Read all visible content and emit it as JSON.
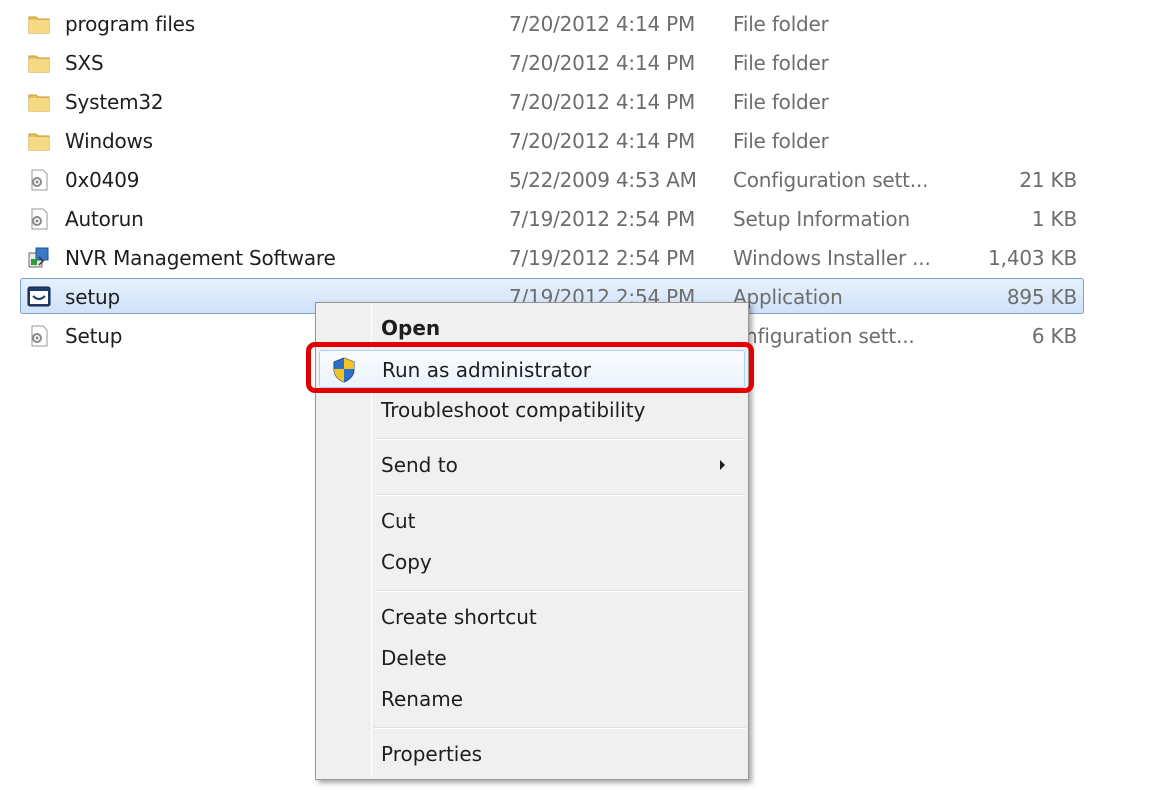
{
  "files": [
    {
      "name": "program files",
      "date": "7/20/2012 4:14 PM",
      "type": "File folder",
      "size": "",
      "icon": "folder-icon"
    },
    {
      "name": "SXS",
      "date": "7/20/2012 4:14 PM",
      "type": "File folder",
      "size": "",
      "icon": "folder-icon"
    },
    {
      "name": "System32",
      "date": "7/20/2012 4:14 PM",
      "type": "File folder",
      "size": "",
      "icon": "folder-icon"
    },
    {
      "name": "Windows",
      "date": "7/20/2012 4:14 PM",
      "type": "File folder",
      "size": "",
      "icon": "folder-icon"
    },
    {
      "name": "0x0409",
      "date": "5/22/2009 4:53 AM",
      "type": "Configuration sett...",
      "size": "21 KB",
      "icon": "config-file-icon"
    },
    {
      "name": "Autorun",
      "date": "7/19/2012 2:54 PM",
      "type": "Setup Information",
      "size": "1 KB",
      "icon": "config-file-icon"
    },
    {
      "name": "NVR Management Software",
      "date": "7/19/2012 2:54 PM",
      "type": "Windows Installer ...",
      "size": "1,403 KB",
      "icon": "installer-icon"
    },
    {
      "name": "setup",
      "date": "7/19/2012 2:54 PM",
      "type": "Application",
      "size": "895 KB",
      "icon": "application-icon",
      "selected": true
    },
    {
      "name": "Setup",
      "date": "",
      "type": "onfiguration sett...",
      "size": "6 KB",
      "icon": "config-file-icon"
    }
  ],
  "context_menu": {
    "open": "Open",
    "run_as_admin": "Run as administrator",
    "troubleshoot": "Troubleshoot compatibility",
    "send_to": "Send to",
    "cut": "Cut",
    "copy": "Copy",
    "create_shortcut": "Create shortcut",
    "delete": "Delete",
    "rename": "Rename",
    "properties": "Properties"
  },
  "colors": {
    "highlight_box": "#e30000",
    "selection_border": "#7da2ce",
    "folder": "#e8c25a"
  }
}
